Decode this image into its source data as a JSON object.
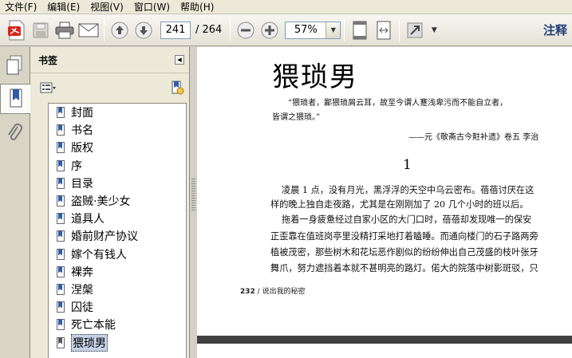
{
  "menu": [
    {
      "label": "文件(F)"
    },
    {
      "label": "编辑(E)"
    },
    {
      "label": "视图(V)"
    },
    {
      "label": "窗口(W)"
    },
    {
      "label": "帮助(H)"
    }
  ],
  "toolbar": {
    "current_page": "241",
    "total_pages": "/ 264",
    "zoom": "57%",
    "annotate_label": "注释"
  },
  "sidebar": {
    "title": "书签",
    "bookmarks": [
      {
        "label": "封面"
      },
      {
        "label": "书名"
      },
      {
        "label": "版权"
      },
      {
        "label": "序"
      },
      {
        "label": "目录"
      },
      {
        "label": "盗贼·美少女"
      },
      {
        "label": "道具人"
      },
      {
        "label": "婚前财产协议"
      },
      {
        "label": "嫁个有钱人"
      },
      {
        "label": "裸奔"
      },
      {
        "label": "涅槃"
      },
      {
        "label": "囚徒"
      },
      {
        "label": "死亡本能"
      },
      {
        "label": "猥琐男"
      }
    ],
    "selected_index": 13
  },
  "document": {
    "chapter_title": "猥琐男",
    "epigraph_line1": "“猥琐者，鄙猥琐屑云耳，故至今谓人蹇浅卑污而不能自立者，",
    "epigraph_line2": "皆谓之猥琐。”",
    "epigraph_source": "——元《敬斋古今黈补遗》卷五   李治",
    "section_number": "1",
    "body_lines": [
      "凌晨 1 点，没有月光，黑浮浮的天空中乌云密布。蓓蓓讨厌在这",
      "样的晚上独自走夜路，尤其是在刚刚加了 20 几个小时的班以后。",
      "拖着一身疲惫经过自家小区的大门口时，蓓蓓却发现唯一的保安",
      "正歪靠在值班岗亭里没精打采地打着瞌睡。而通向楼门的石子路两旁",
      "植被茂密，那些树木和花坛恶作剧似的纷纷伸出自己茂盛的枝叶张牙",
      "舞爪，努力遮挡着本就不甚明亮的路灯。偌大的院落中树影斑驳，只"
    ],
    "footer_page": "232",
    "footer_text": "/ 说出我的秘密"
  },
  "colors": {
    "toolbar_bg": "#e4e2d6",
    "panel_bg": "#ece9d8",
    "selection": "#c5d2e7",
    "accent": "#1f3e78"
  }
}
